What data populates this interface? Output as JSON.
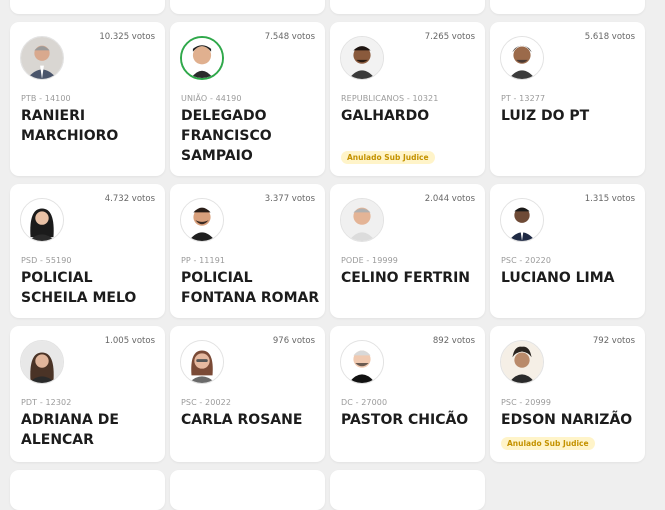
{
  "candidates": [
    {
      "votes": "10.325 votos",
      "party": "PTB - 14100",
      "name": "RANIERI MARCHIORO",
      "badge": ""
    },
    {
      "votes": "7.548 votos",
      "party": "UNIÃO - 44190",
      "name": "DELEGADO FRANCISCO SAMPAIO",
      "badge": ""
    },
    {
      "votes": "7.265 votos",
      "party": "REPUBLICANOS - 10321",
      "name": "GALHARDO",
      "badge": "Anulado Sub Judice"
    },
    {
      "votes": "5.618 votos",
      "party": "PT - 13277",
      "name": "LUIZ DO PT",
      "badge": ""
    },
    {
      "votes": "4.732 votos",
      "party": "PSD - 55190",
      "name": "POLICIAL SCHEILA MELO",
      "badge": ""
    },
    {
      "votes": "3.377 votos",
      "party": "PP - 11191",
      "name": "POLICIAL FONTANA ROMAR",
      "badge": ""
    },
    {
      "votes": "2.044 votos",
      "party": "PODE - 19999",
      "name": "CELINO FERTRIN",
      "badge": ""
    },
    {
      "votes": "1.315 votos",
      "party": "PSC - 20220",
      "name": "LUCIANO LIMA",
      "badge": ""
    },
    {
      "votes": "1.005 votos",
      "party": "PDT - 12302",
      "name": "ADRIANA DE ALENCAR",
      "badge": ""
    },
    {
      "votes": "976 votos",
      "party": "PSC - 20022",
      "name": "CARLA ROSANE",
      "badge": ""
    },
    {
      "votes": "892 votos",
      "party": "DC - 27000",
      "name": "PASTOR CHICÃO",
      "badge": ""
    },
    {
      "votes": "792 votos",
      "party": "PSC - 20999",
      "name": "EDSON NARIZÃO",
      "badge": "Anulado Sub Judice"
    }
  ],
  "colors": {
    "background": "#efefef",
    "card": "#ffffff",
    "badge_text": "#c49200",
    "badge_bg": "#fff4c9"
  }
}
